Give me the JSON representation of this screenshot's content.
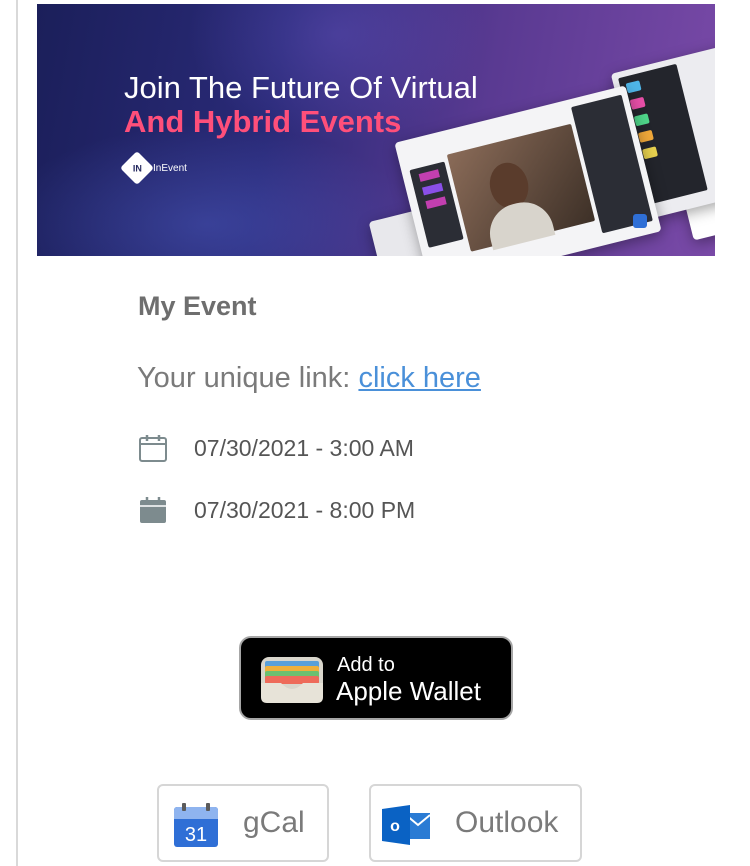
{
  "banner": {
    "headline_line1": "Join The Future Of Virtual",
    "headline_line2": "And Hybrid Events",
    "brand_mark": "IN",
    "brand_name": "InEvent",
    "colors": {
      "background_start": "#1b1f5a",
      "background_end": "#7a4aa8",
      "accent": "#ff4f7a"
    }
  },
  "event": {
    "name": "My Event",
    "link_prefix": "Your unique link: ",
    "link_text": "click here",
    "start": "07/30/2021 - 3:00 AM",
    "end": "07/30/2021 - 8:00 PM",
    "start_icon": "calendar-outline-icon",
    "end_icon": "calendar-filled-icon"
  },
  "wallet": {
    "line1": "Add to",
    "line2": "Apple Wallet",
    "icon": "apple-wallet-icon"
  },
  "calendar_buttons": {
    "gcal": {
      "label": "gCal",
      "icon": "google-calendar-icon",
      "icon_text": "31"
    },
    "outlook": {
      "label": "Outlook",
      "icon": "outlook-icon",
      "icon_text": "o"
    }
  },
  "colors": {
    "link": "#4a90d9",
    "text": "#6e6e6e",
    "wallet_bg": "#000000"
  }
}
